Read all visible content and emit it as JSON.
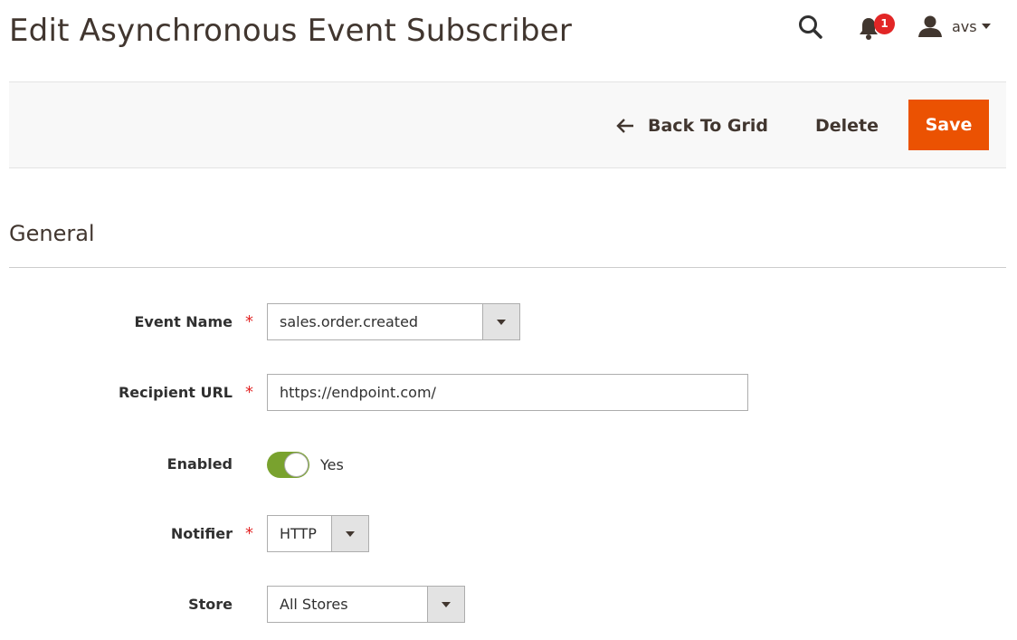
{
  "page": {
    "title": "Edit Asynchronous Event Subscriber"
  },
  "header": {
    "notification_count": "1",
    "user_name": "avs"
  },
  "actions": {
    "back_label": "Back To Grid",
    "delete_label": "Delete",
    "save_label": "Save"
  },
  "section": {
    "title": "General"
  },
  "form": {
    "required_marker": "*",
    "event_name": {
      "label": "Event Name",
      "value": "sales.order.created",
      "required": true
    },
    "recipient_url": {
      "label": "Recipient URL",
      "value": "https://endpoint.com/",
      "required": true
    },
    "enabled": {
      "label": "Enabled",
      "value_text": "Yes",
      "checked": true
    },
    "notifier": {
      "label": "Notifier",
      "value": "HTTP",
      "required": true
    },
    "store": {
      "label": "Store",
      "value": "All Stores"
    }
  },
  "colors": {
    "accent": "#eb5202",
    "toggle_on": "#79a22e",
    "required": "#e22626",
    "badge": "#e22626"
  },
  "icons": {
    "search": "search-icon",
    "notifications": "bell-icon",
    "user": "user-icon",
    "back": "arrow-left-icon"
  }
}
